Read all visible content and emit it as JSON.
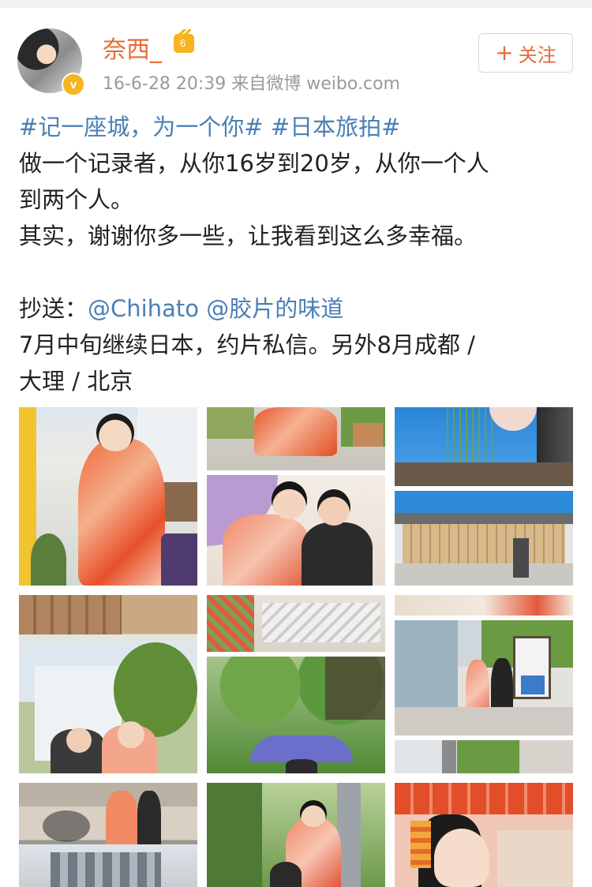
{
  "post": {
    "username": "奈西_",
    "meta": "16-6-28 20:39  来自微博 weibo.com",
    "follow_label": "关注",
    "verified_mark": "v",
    "crown_badge": "6"
  },
  "content": {
    "tag1": "#记一座城，为一个你#",
    "tag2": "#日本旅拍#",
    "line1": "做一个记录者，从你16岁到20岁，从你一个人",
    "line2": "到两个人。",
    "line3": "其实，谢谢你多一些，让我看到这么多幸福。",
    "cc_label": "抄送：",
    "mention1": "@Chihato",
    "mention2": "@胶片的味道",
    "line5": "7月中旬继续日本，约片私信。另外8月成都 /",
    "line6": "大理 / 北京"
  },
  "photos": [
    "kimono-portrait-street",
    "kimono-crouching",
    "blue-sky-willow",
    "couple-umbrella",
    "wooden-house",
    "wooden-plaques",
    "paper-fortunes",
    "temple-couple",
    "couple-smiling",
    "trees-purple-umbrella",
    "street-path",
    "trees-lantern",
    "kimono-shrine-gate",
    "portrait-umbrella-close",
    "alley-lanterns"
  ]
}
